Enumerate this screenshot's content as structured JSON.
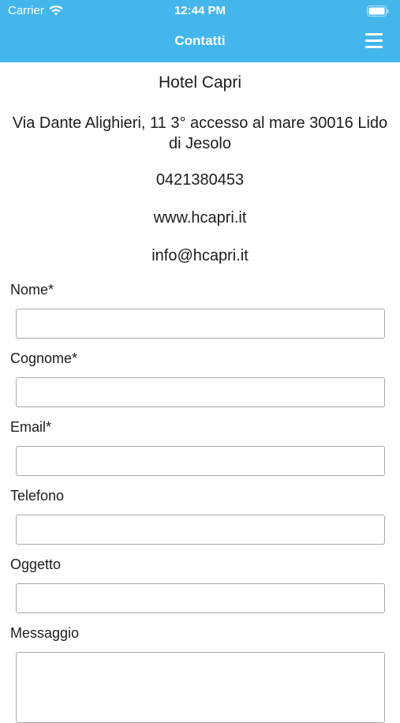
{
  "status_bar": {
    "carrier": "Carrier",
    "time": "12:44 PM"
  },
  "nav": {
    "title": "Contatti",
    "menu_icon": "hamburger-menu-icon"
  },
  "hotel": {
    "name": "Hotel Capri",
    "address": "Via Dante Alighieri, 11 3° accesso al mare 30016 Lido di Jesolo",
    "phone": "0421380453",
    "website": "www.hcapri.it",
    "email": "info@hcapri.it"
  },
  "form": {
    "nome_label": "Nome*",
    "nome_value": "",
    "cognome_label": "Cognome*",
    "cognome_value": "",
    "email_label": "Email*",
    "email_value": "",
    "telefono_label": "Telefono",
    "telefono_value": "",
    "oggetto_label": "Oggetto",
    "oggetto_value": "",
    "messaggio_label": "Messaggio",
    "messaggio_value": ""
  },
  "colors": {
    "header_bg": "#44b6ec",
    "header_text": "#ffffff",
    "input_border": "#a8a8a8"
  }
}
